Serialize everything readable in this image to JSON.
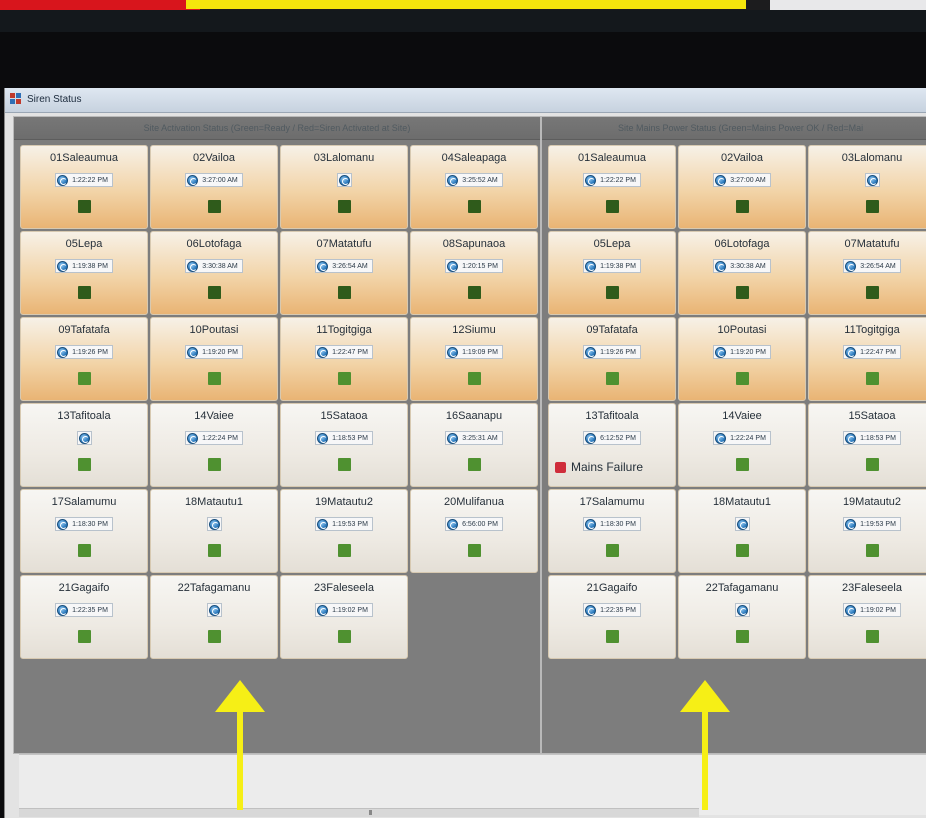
{
  "window": {
    "title": "Siren Status"
  },
  "left_panel": {
    "header": "Site Activation Status (Green=Ready / Red=Siren Activated at Site)",
    "tiles": [
      {
        "name": "01Saleaumua",
        "time": "1:22:22 PM",
        "indicator": "dark"
      },
      {
        "name": "02Vailoa",
        "time": "3:27:00 AM",
        "indicator": "dark"
      },
      {
        "name": "03Lalomanu",
        "time": "",
        "indicator": "dark"
      },
      {
        "name": "04Saleapaga",
        "time": "3:25:52 AM",
        "indicator": "dark"
      },
      {
        "name": "05Lepa",
        "time": "1:19:38 PM",
        "indicator": "dark"
      },
      {
        "name": "06Lotofaga",
        "time": "3:30:38 AM",
        "indicator": "dark"
      },
      {
        "name": "07Matatufu",
        "time": "3:26:54 AM",
        "indicator": "dark"
      },
      {
        "name": "08Sapunaoa",
        "time": "1:20:15 PM",
        "indicator": "dark"
      },
      {
        "name": "09Tafatafa",
        "time": "1:19:26 PM",
        "indicator": "green"
      },
      {
        "name": "10Poutasi",
        "time": "1:19:20 PM",
        "indicator": "green"
      },
      {
        "name": "11Togitgiga",
        "time": "1:22:47 PM",
        "indicator": "green"
      },
      {
        "name": "12Siumu",
        "time": "1:19:09 PM",
        "indicator": "green"
      },
      {
        "name": "13Tafitoala",
        "time": "",
        "indicator": "green"
      },
      {
        "name": "14Vaiee",
        "time": "1:22:24 PM",
        "indicator": "green"
      },
      {
        "name": "15Sataoa",
        "time": "1:18:53 PM",
        "indicator": "green"
      },
      {
        "name": "16Saanapu",
        "time": "3:25:31 AM",
        "indicator": "green"
      },
      {
        "name": "17Salamumu",
        "time": "1:18:30 PM",
        "indicator": "green"
      },
      {
        "name": "18Matautu1",
        "time": "",
        "indicator": "green"
      },
      {
        "name": "19Matautu2",
        "time": "1:19:53 PM",
        "indicator": "green"
      },
      {
        "name": "20Mulifanua",
        "time": "6:56:00 PM",
        "indicator": "green"
      },
      {
        "name": "21Gagaifo",
        "time": "1:22:35 PM",
        "indicator": "green"
      },
      {
        "name": "22Tafagamanu",
        "time": "",
        "indicator": "green"
      },
      {
        "name": "23Faleseela",
        "time": "1:19:02 PM",
        "indicator": "green"
      }
    ]
  },
  "right_panel": {
    "header": "Site Mains Power Status (Green=Mains Power OK / Red=Mai",
    "tiles": [
      {
        "name": "01Saleaumua",
        "time": "1:22:22 PM",
        "indicator": "dark"
      },
      {
        "name": "02Vailoa",
        "time": "3:27:00 AM",
        "indicator": "dark"
      },
      {
        "name": "03Lalomanu",
        "time": "",
        "indicator": "dark"
      },
      {
        "name": "05Lepa",
        "time": "1:19:38 PM",
        "indicator": "dark"
      },
      {
        "name": "06Lotofaga",
        "time": "3:30:38 AM",
        "indicator": "dark"
      },
      {
        "name": "07Matatufu",
        "time": "3:26:54 AM",
        "indicator": "dark"
      },
      {
        "name": "09Tafatafa",
        "time": "1:19:26 PM",
        "indicator": "green"
      },
      {
        "name": "10Poutasi",
        "time": "1:19:20 PM",
        "indicator": "green"
      },
      {
        "name": "11Togitgiga",
        "time": "1:22:47 PM",
        "indicator": "green"
      },
      {
        "name": "13Tafitoala",
        "time": "6:12:52 PM",
        "indicator": "mains",
        "mains_label": "Mains Failure"
      },
      {
        "name": "14Vaiee",
        "time": "1:22:24 PM",
        "indicator": "green"
      },
      {
        "name": "15Sataoa",
        "time": "1:18:53 PM",
        "indicator": "green"
      },
      {
        "name": "17Salamumu",
        "time": "1:18:30 PM",
        "indicator": "green"
      },
      {
        "name": "18Matautu1",
        "time": "",
        "indicator": "green"
      },
      {
        "name": "19Matautu2",
        "time": "1:19:53 PM",
        "indicator": "green"
      },
      {
        "name": "21Gagaifo",
        "time": "1:22:35 PM",
        "indicator": "green"
      },
      {
        "name": "22Tafagamanu",
        "time": "",
        "indicator": "green"
      },
      {
        "name": "23Faleseela",
        "time": "1:19:02 PM",
        "indicator": "green"
      }
    ]
  },
  "colors": {
    "ready_dark": "#2f5b1b",
    "ready_green": "#4f9130",
    "failure_red": "#cf2d3b",
    "annotation_arrow": "#f6ef16"
  },
  "icons": {
    "tile_refresh": "refresh-icon",
    "app": "app-grid-icon"
  }
}
